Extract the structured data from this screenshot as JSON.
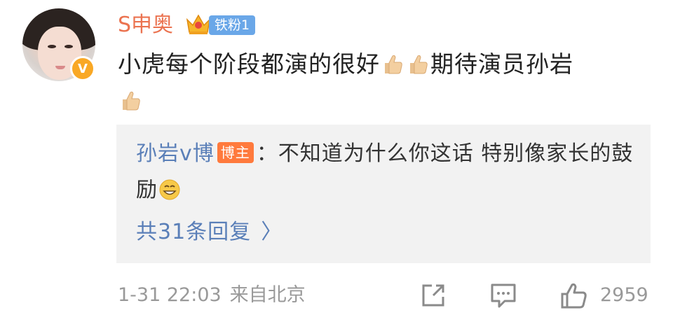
{
  "user": {
    "name": "S申奥",
    "fan_badge": "铁粉1",
    "verified_label": "V"
  },
  "comment": {
    "text_part1": "小虎每个阶段都演的很好",
    "text_part2": "期待演员孙岩"
  },
  "reply": {
    "author": "孙岩v博",
    "host_badge": "博主",
    "separator": "：",
    "text": "不知道为什么你这话 特别像家长的鼓励"
  },
  "reply_count_label": "共31条回复",
  "reply_count_chevron": "〉",
  "footer": {
    "time": "1-31 22:03",
    "source": "来自北京",
    "like_count": "2959"
  },
  "icons": [
    "crown-icon",
    "thumbs-up-emoji-icon",
    "grin-emoji-icon",
    "share-icon",
    "comment-icon",
    "like-icon"
  ],
  "colors": {
    "username": "#eb7350",
    "link": "#5a7fb8",
    "fan_badge": "#6aa7e8",
    "host_badge": "#ff7a3d",
    "verified": "#f9a825"
  }
}
